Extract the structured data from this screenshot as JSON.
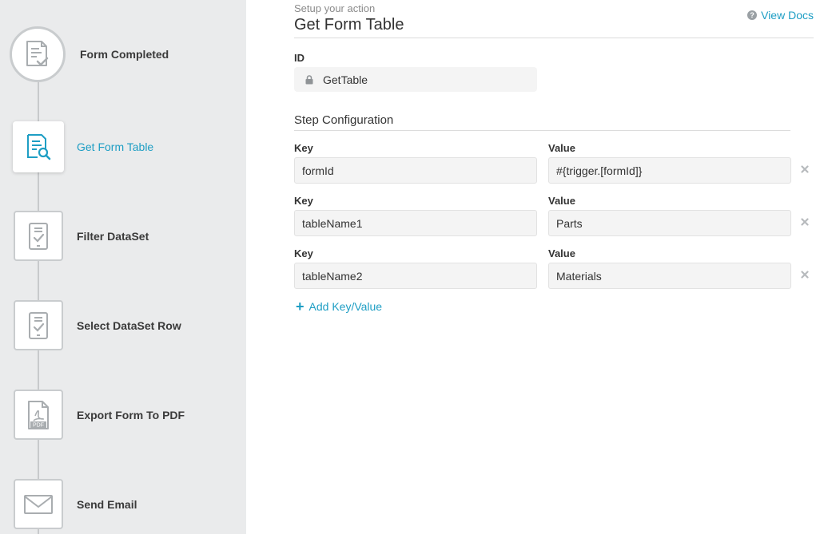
{
  "sidebar": {
    "steps": [
      {
        "label": "Form Completed",
        "icon": "form-check-icon"
      },
      {
        "label": "Get Form Table",
        "icon": "form-search-icon",
        "active": true
      },
      {
        "label": "Filter DataSet",
        "icon": "tablet-check-icon"
      },
      {
        "label": "Select DataSet Row",
        "icon": "tablet-check-icon"
      },
      {
        "label": "Export Form To PDF",
        "icon": "pdf-file-icon"
      },
      {
        "label": "Send Email",
        "icon": "envelope-icon"
      }
    ]
  },
  "header": {
    "subtitle": "Setup your action",
    "title": "Get Form Table",
    "view_docs": "View Docs",
    "help_glyph": "?"
  },
  "id_section": {
    "label": "ID",
    "value": "GetTable"
  },
  "config": {
    "title": "Step Configuration",
    "rows": [
      {
        "key_label": "Key",
        "value_label": "Value",
        "key": "formId",
        "value": "#{trigger.[formId]}"
      },
      {
        "key_label": "Key",
        "value_label": "Value",
        "key": "tableName1",
        "value": "Parts"
      },
      {
        "key_label": "Key",
        "value_label": "Value",
        "key": "tableName2",
        "value": "Materials"
      }
    ],
    "add_label": "Add Key/Value",
    "add_glyph": "+"
  },
  "colors": {
    "accent": "#1e9ec4",
    "sidebar_bg": "#eaebec",
    "icon_gray": "#a9adb0"
  }
}
